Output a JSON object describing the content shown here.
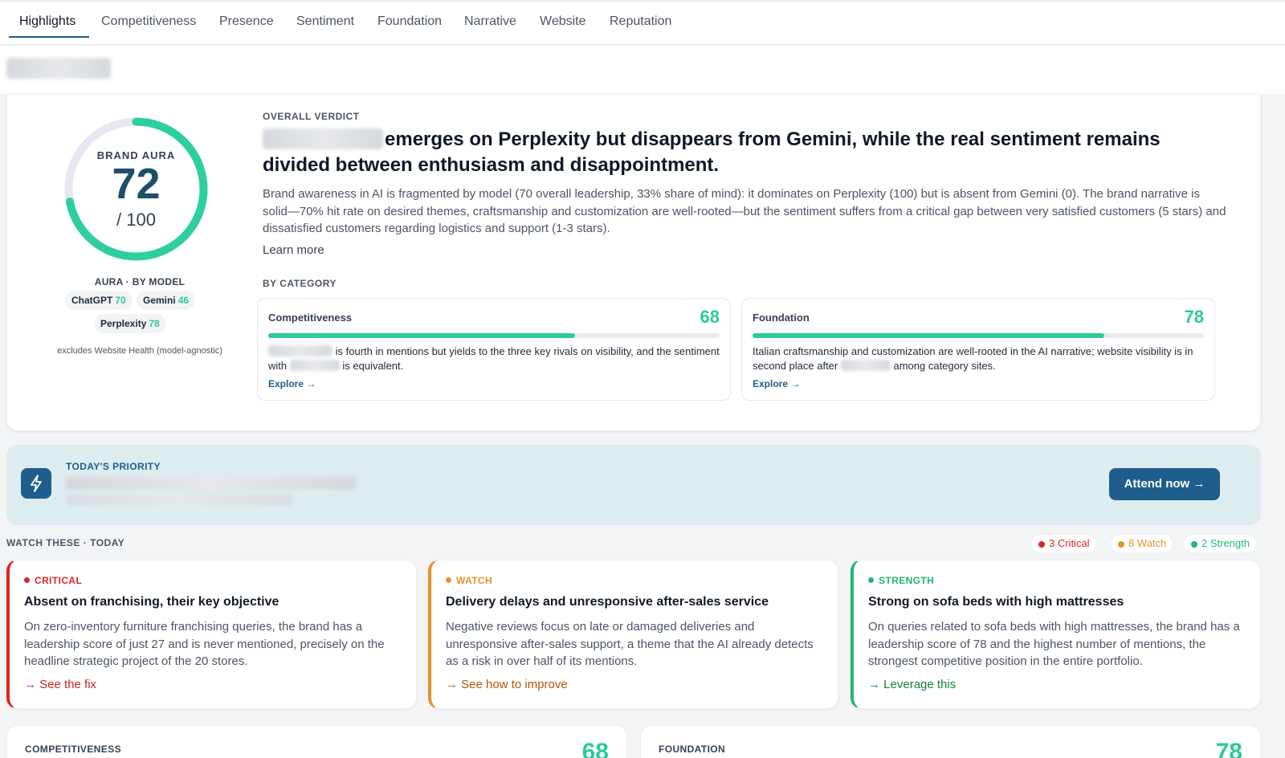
{
  "tabs": [
    {
      "label": "Highlights",
      "active": true
    },
    {
      "label": "Competitiveness"
    },
    {
      "label": "Presence"
    },
    {
      "label": "Sentiment"
    },
    {
      "label": "Foundation"
    },
    {
      "label": "Narrative"
    },
    {
      "label": "Website"
    },
    {
      "label": "Reputation"
    }
  ],
  "aura": {
    "brand_label": "BRAND AURA",
    "score": "72",
    "denominator": "/ 100",
    "progress": 0.72,
    "by_model_label": "AURA · BY MODEL",
    "models": [
      {
        "name": "ChatGPT",
        "value": "70"
      },
      {
        "name": "Gemini",
        "value": "46"
      },
      {
        "name": "Perplexity",
        "value": "78"
      }
    ],
    "note": "excludes Website Health (model-agnostic)"
  },
  "verdict": {
    "eyebrow": "OVERALL VERDICT",
    "headline": "emerges on Perplexity but disappears from Gemini, while the real sentiment remains divided between enthusiasm and disappointment.",
    "body": "Brand awareness in AI is fragmented by model (70 overall leadership, 33% share of mind): it dominates on Perplexity (100) but is absent from Gemini (0). The brand narrative is solid—70% hit rate on desired themes, craftsmanship and customization are well-rooted—but the sentiment suffers from a critical gap between very satisfied customers (5 stars) and dissatisfied customers regarding logistics and support (1-3 stars).",
    "learn_more": "Learn more"
  },
  "by_category": {
    "label": "BY CATEGORY",
    "explore": "Explore →",
    "items": [
      {
        "name": "Competitiveness",
        "score": "68",
        "fill": 0.68,
        "text_a": "is fourth in mentions but yields to the three key rivals on visibility, and the sentiment with",
        "text_b": "is equivalent."
      },
      {
        "name": "Foundation",
        "score": "78",
        "fill": 0.78,
        "text_a": "Italian craftsmanship and customization are well-rooted in the AI narrative; website visibility is in second place after",
        "text_b": "among category sites."
      }
    ]
  },
  "priority": {
    "eyebrow": "TODAY'S PRIORITY",
    "button": "Attend now →"
  },
  "watch": {
    "label": "WATCH THESE · TODAY",
    "pills": [
      {
        "text": "3 Critical",
        "color": "#dc2626"
      },
      {
        "text": "8 Watch",
        "color": "#e5922a"
      },
      {
        "text": "2 Strength",
        "color": "#22b573"
      }
    ],
    "cards": [
      {
        "kicker": "CRITICAL",
        "color": "#dc2626",
        "title": "Absent on franchising, their key objective",
        "body": "On zero-inventory furniture franchising queries, the brand has a leadership score of just 27 and is never mentioned, precisely on the headline strategic project of the 20 stores.",
        "link": "→ See the fix",
        "link_color": "#c62828"
      },
      {
        "kicker": "WATCH",
        "color": "#e5922a",
        "title": "Delivery delays and unresponsive after-sales service",
        "body": "Negative reviews focus on late or damaged deliveries and unresponsive after-sales support, a theme that the AI already detects as a risk in over half of its mentions.",
        "link": "→ See how to improve",
        "link_color": "#b45309"
      },
      {
        "kicker": "STRENGTH",
        "color": "#22b573",
        "title": "Strong on sofa beds with high mattresses",
        "body": "On queries related to sofa beds with high mattresses, the brand has a leadership score of 78 and the highest number of mentions, the strongest competitive position in the entire portfolio.",
        "link": "→ Leverage this",
        "link_color": "#15803d"
      }
    ]
  },
  "bottom": [
    {
      "label": "COMPETITIVENESS",
      "score": "68"
    },
    {
      "label": "FOUNDATION",
      "score": "78"
    }
  ],
  "colors": {
    "accent": "#1e5d8c",
    "score_green": "#2ec99b"
  }
}
